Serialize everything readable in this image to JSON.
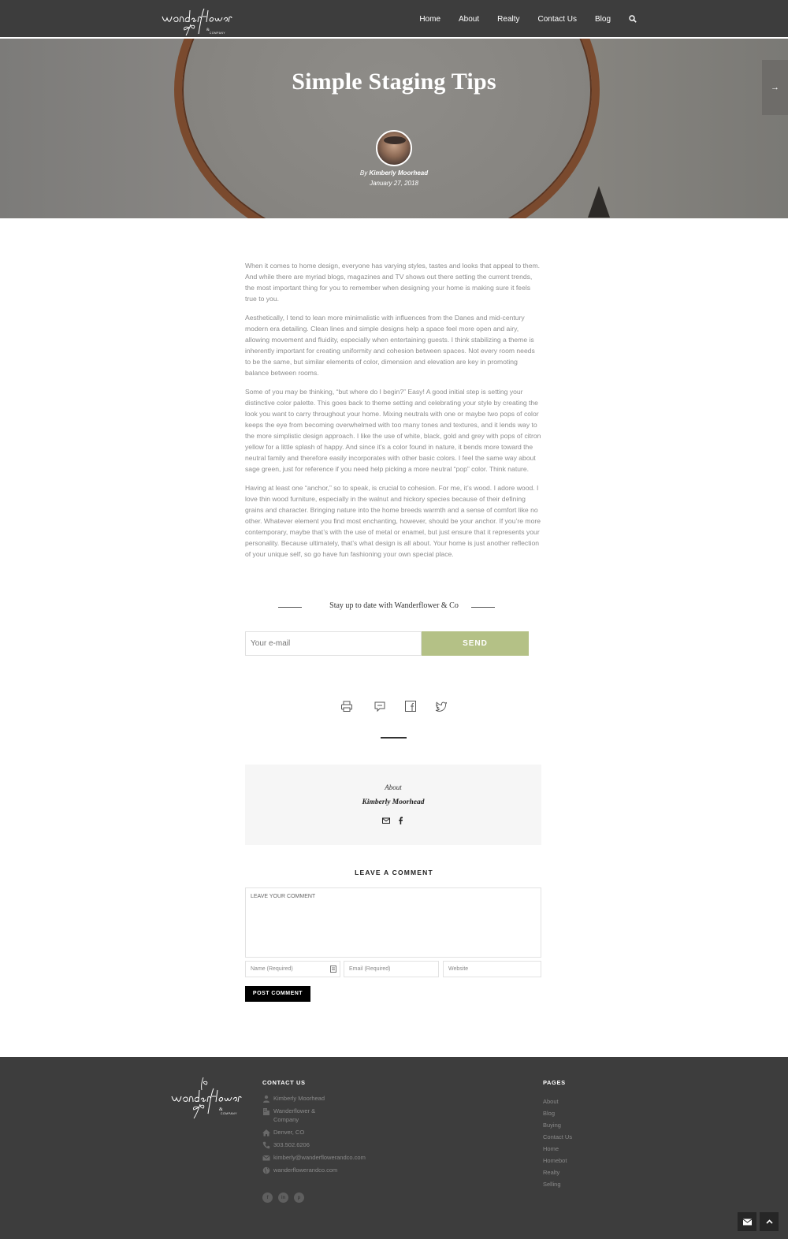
{
  "header": {
    "logo_text": "Wanderflower & Company",
    "nav": [
      "Home",
      "About",
      "Realty",
      "Contact Us",
      "Blog"
    ]
  },
  "hero": {
    "title": "Simple Staging Tips",
    "by_prefix": "By",
    "author": "Kimberly Moorhead",
    "date": "January 27, 2018",
    "arrow": "→"
  },
  "article": {
    "paragraphs": [
      "When it comes to home design, everyone has varying styles, tastes and looks that appeal to them. And while there are myriad blogs, magazines and TV shows out there setting the current trends, the most important thing for you to remember when designing your home is making sure it feels true to you.",
      "Aesthetically, I tend to lean more minimalistic with influences from the Danes and mid-century modern era detailing. Clean lines and simple designs help a space feel more open and airy, allowing movement and fluidity, especially when entertaining guests. I think stabilizing a theme is inherently important for creating uniformity and cohesion between spaces. Not every room needs to be the same, but similar elements of color, dimension and elevation are key in promoting balance between rooms.",
      "Some of you may be thinking, “but where do I begin?” Easy! A good initial step is setting your distinctive color palette. This goes back to theme setting and celebrating your style by creating the look you want to carry throughout your home. Mixing neutrals with one or maybe two pops of color keeps the eye from becoming overwhelmed with too many tones and textures, and it lends way to the more simplistic design approach. I like the use of white, black, gold and grey with pops of citron yellow for a little splash of happy. And since it’s a color found in nature, it bends more toward the neutral family and therefore easily incorporates with other basic colors. I feel the same way about sage green, just for reference if you need help picking a more neutral “pop” color. Think nature.",
      "Having at least one “anchor,” so to speak, is crucial to cohesion. For me, it’s wood. I adore wood. I love thin wood furniture, especially in the walnut and hickory species because of their defining grains and character. Bringing nature into the home breeds warmth and a sense of comfort like no other. Whatever element you find most enchanting, however, should be your anchor. If you’re more contemporary, maybe that’s with the use of metal or enamel, but just ensure that it represents your personality. Because ultimately, that’s what design is all about. Your home is just another reflection of your unique self, so go have fun fashioning your own special place."
    ]
  },
  "newsletter": {
    "title": "Stay up to date with Wanderflower & Co",
    "placeholder": "Your e-mail",
    "button": "SEND"
  },
  "about": {
    "label": "About",
    "name": "Kimberly Moorhead"
  },
  "comment": {
    "title": "LEAVE A COMMENT",
    "placeholder": "LEAVE YOUR COMMENT",
    "name_placeholder": "Name (Required)",
    "email_placeholder": "Email (Required)",
    "website_placeholder": "Website",
    "button": "POST COMMENT"
  },
  "footer": {
    "contact_heading": "CONTACT US",
    "contact": [
      {
        "icon": "person-icon",
        "text": "Kimberly Moorhead"
      },
      {
        "icon": "building-icon",
        "text": "Wanderflower & Company"
      },
      {
        "icon": "home-icon",
        "text": "Denver, CO"
      },
      {
        "icon": "phone-icon",
        "text": "303.502.6206"
      },
      {
        "icon": "mail-icon",
        "text": "kimberly@wanderflowerandco.com"
      },
      {
        "icon": "globe-icon",
        "text": "wanderflowerandco.com"
      }
    ],
    "pages_heading": "PAGES",
    "pages": [
      "About",
      "Blog",
      "Buying",
      "Contact Us",
      "Home",
      "Homebot",
      "Realty",
      "Selling"
    ],
    "social": [
      "f",
      "in",
      "p"
    ]
  },
  "colors": {
    "header_bg": "#3d3d3d",
    "accent_green": "#b4c186",
    "footer_bg": "#3d3d3d"
  }
}
